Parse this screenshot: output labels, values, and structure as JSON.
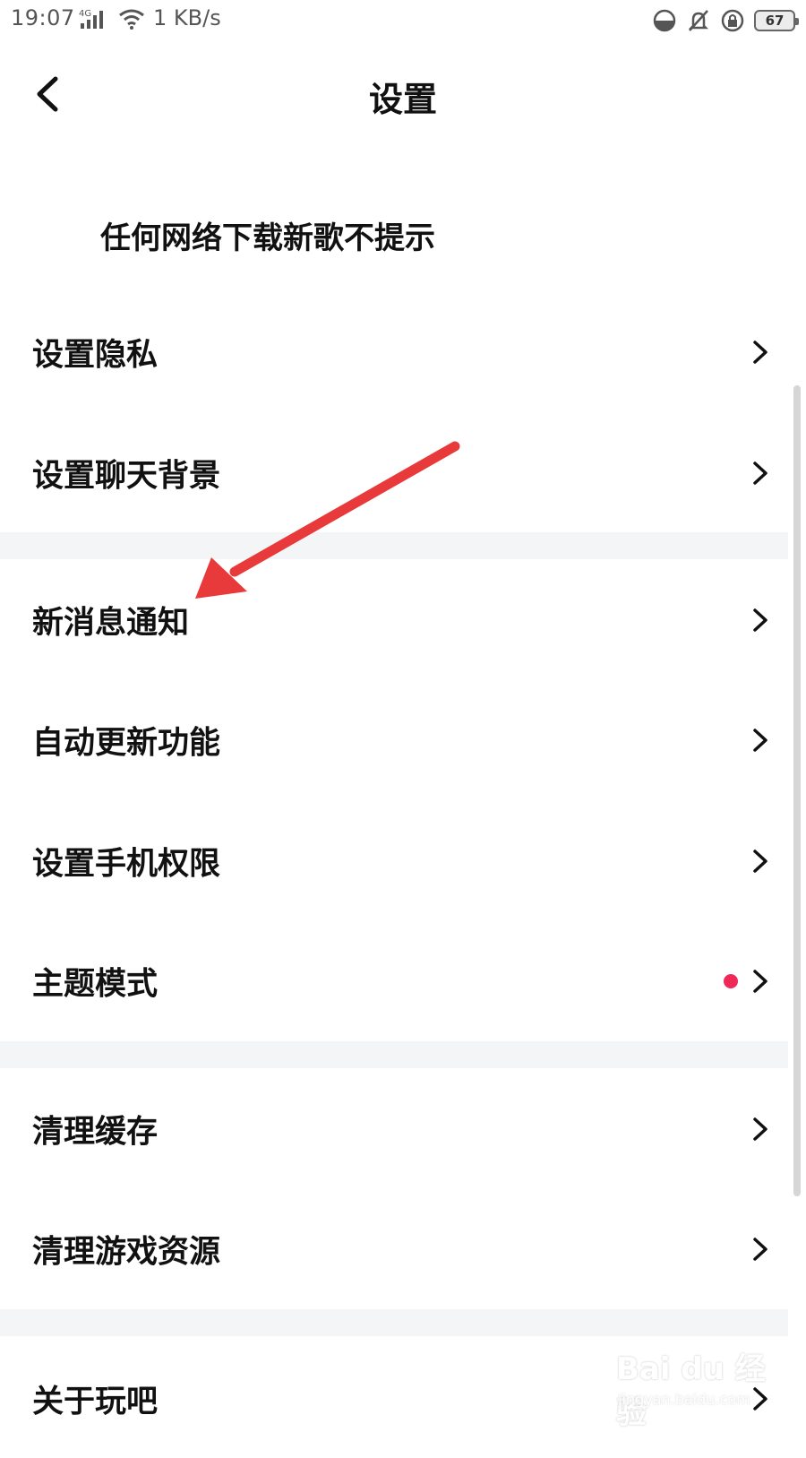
{
  "status_bar": {
    "time": "19:07",
    "network": "4G",
    "speed": "1 KB/s",
    "battery": "67",
    "icons": [
      "signal-icon",
      "wifi-icon",
      "data-saver-icon",
      "bell-off-icon",
      "rotation-lock-icon",
      "battery-icon"
    ]
  },
  "header": {
    "title": "设置",
    "back_icon": "chevron-left-icon"
  },
  "note": "任何网络下载新歌不提示",
  "menu": [
    {
      "label": "设置隐私"
    },
    {
      "label": "设置聊天背景"
    },
    {
      "label": "新消息通知"
    },
    {
      "label": "自动更新功能"
    },
    {
      "label": "设置手机权限"
    },
    {
      "label": "主题模式",
      "badge": "red-dot"
    },
    {
      "label": "清理缓存"
    },
    {
      "label": "清理游戏资源"
    },
    {
      "label": "关于玩吧"
    }
  ],
  "colors": {
    "badge": "#f0285a",
    "annotation_arrow": "#e83a3a",
    "section_gap": "#f4f5f7"
  },
  "watermark": {
    "logo": "Bai du 经验",
    "url": "jingyan.baidu.com"
  }
}
